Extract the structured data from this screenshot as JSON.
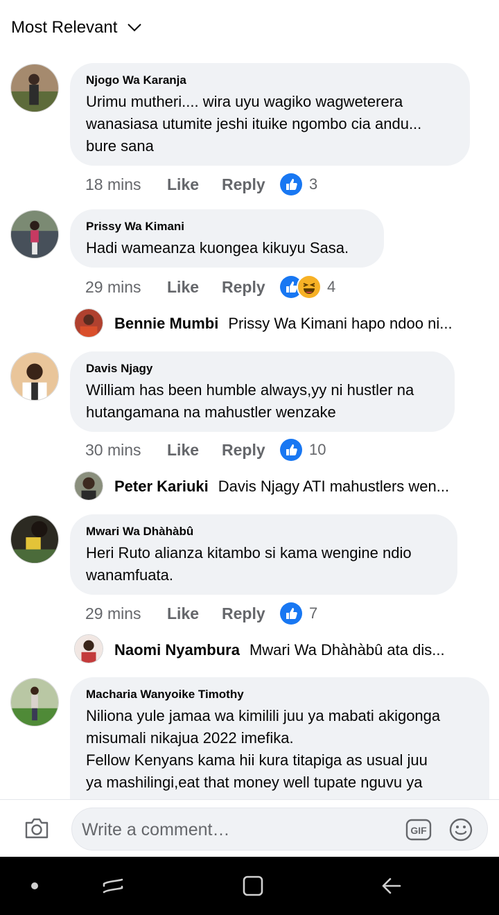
{
  "sort": {
    "label": "Most Relevant"
  },
  "colors": {
    "like_blue": "#1877f2",
    "bubble_bg": "#f0f2f5",
    "meta_gray": "#65676b",
    "haha_yellow": "#f7b125"
  },
  "comments": [
    {
      "name": "Njogo Wa Karanja",
      "text": "Urimu mutheri.... wira uyu wagiko wagweterera\nwanasiasa utumite jeshi ituike ngombo cia andu...\nbure sana",
      "time": "18 mins",
      "like": "Like",
      "reply": "Reply",
      "reactions": [
        "like-icon"
      ],
      "count": "3"
    },
    {
      "name": "Prissy Wa Kimani",
      "text": "Hadi wameanza kuongea kikuyu Sasa.",
      "time": "29 mins",
      "like": "Like",
      "reply": "Reply",
      "reactions": [
        "like-icon",
        "haha-icon"
      ],
      "count": "4",
      "reply_preview": {
        "name": "Bennie Mumbi",
        "text": "Prissy Wa Kimani hapo ndoo ni..."
      }
    },
    {
      "name": "Davis Njagy",
      "text": "William has been humble always,yy ni hustler na\nhutangamana na mahustler wenzake",
      "time": "30 mins",
      "like": "Like",
      "reply": "Reply",
      "reactions": [
        "like-icon"
      ],
      "count": "10",
      "reply_preview": {
        "name": "Peter Kariuki",
        "text": "Davis Njagy ATI mahustlers wen..."
      }
    },
    {
      "name": "Mwari Wa Dhàhàbû",
      "text": "Heri Ruto alianza kitambo si kama wengine ndio\nwanamfuata.",
      "time": "29 mins",
      "like": "Like",
      "reply": "Reply",
      "reactions": [
        "like-icon"
      ],
      "count": "7",
      "reply_preview": {
        "name": "Naomi Nyambura",
        "text": "Mwari Wa Dhàhàbû ata dis..."
      }
    },
    {
      "name": "Macharia Wanyoike Timothy",
      "text": "Niliona yule jamaa wa kimilili juu ya mabati akigonga\nmisumali nikajua 2022 imefika.\nFellow Kenyans kama hii kura titapiga as usual juu\nya mashilingi,eat that money well tupate nguvu ya"
    }
  ],
  "composer": {
    "placeholder": "Write a comment…",
    "gif_label": "GIF"
  }
}
